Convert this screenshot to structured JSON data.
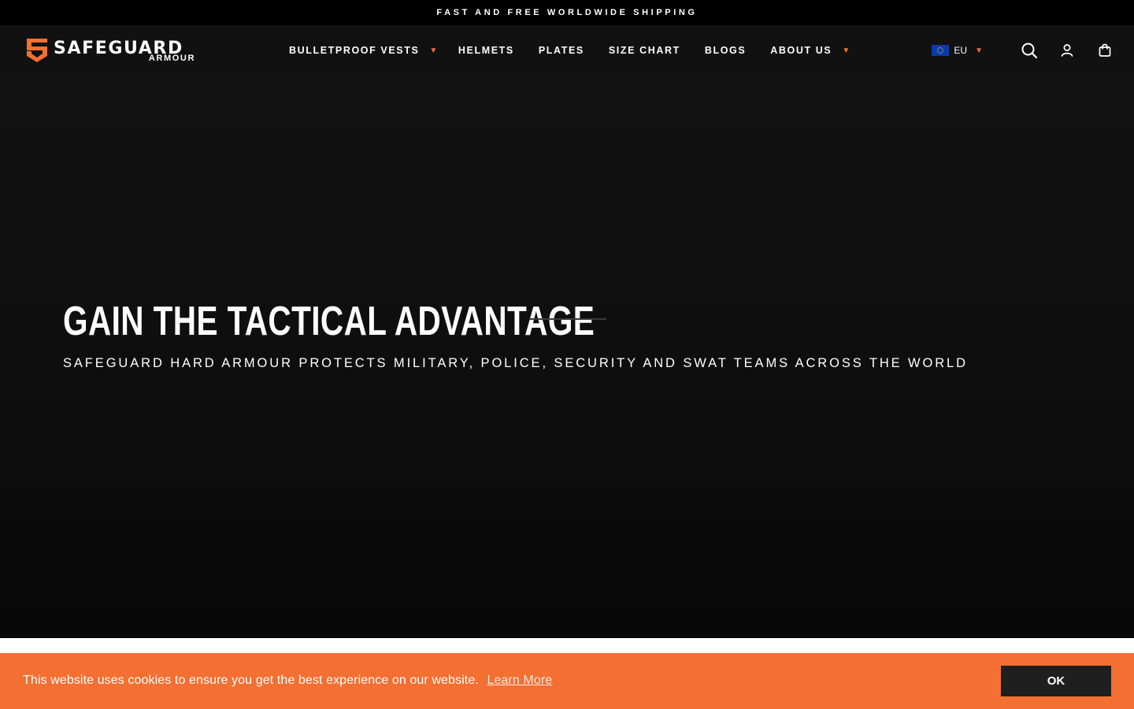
{
  "announcement": "FAST AND FREE WORLDWIDE SHIPPING",
  "brand": {
    "name": "SAFEGUARD",
    "sub": "ARMOUR",
    "accent_color": "#f36f32"
  },
  "nav": {
    "items": [
      {
        "label": "BULLETPROOF VESTS",
        "has_dropdown": true
      },
      {
        "label": "HELMETS",
        "has_dropdown": false
      },
      {
        "label": "PLATES",
        "has_dropdown": false
      },
      {
        "label": "SIZE CHART",
        "has_dropdown": false
      },
      {
        "label": "BLOGS",
        "has_dropdown": false
      },
      {
        "label": "ABOUT US",
        "has_dropdown": true
      }
    ]
  },
  "locale": {
    "code": "EU",
    "flag_icon": "eu-flag-icon"
  },
  "tools": {
    "icons": [
      "search-icon",
      "account-icon",
      "cart-icon"
    ]
  },
  "hero": {
    "title": "GAIN THE TACTICAL ADVANTAGE",
    "subtitle": "SAFEGUARD HARD ARMOUR PROTECTS MILITARY, POLICE, SECURITY AND SWAT TEAMS ACROSS THE WORLD"
  },
  "cookie": {
    "message": "This website uses cookies to ensure you get the best experience on our website.",
    "link_label": "Learn More",
    "ok_label": "OK"
  }
}
